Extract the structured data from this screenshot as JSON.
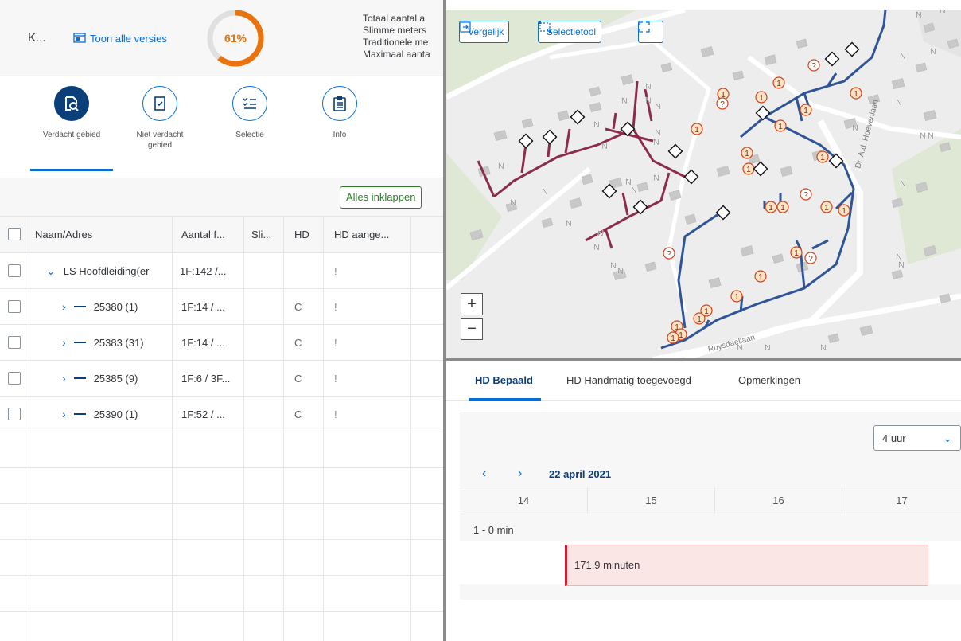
{
  "header": {
    "title": "K...",
    "versions_link": "Toon alle versies",
    "progress_percent": 61,
    "progress_label": "61%",
    "stats": [
      "Totaal aantal a",
      "Slimme meters",
      "Traditionele me",
      "Maximaal aanta"
    ]
  },
  "modes": [
    {
      "label": "Verdacht gebied",
      "icon": "magnifier-document-icon",
      "active": true
    },
    {
      "label": "Niet verdacht gebied",
      "icon": "checklist-document-icon",
      "active": false
    },
    {
      "label": "Selectie",
      "icon": "list-check-icon",
      "active": false
    },
    {
      "label": "Info",
      "icon": "clipboard-info-icon",
      "active": false
    }
  ],
  "toolbar": {
    "collapse_label": "Alles inklappen"
  },
  "table": {
    "columns": [
      "Naam/Adres",
      "Aantal f...",
      "Sli...",
      "HD",
      "HD aange..."
    ],
    "rows": [
      {
        "name": "LS Hoofdleiding(er",
        "aantal": "1F:142 /...",
        "sli": "",
        "hd": "",
        "hd_aange": "!",
        "expanded": true
      },
      {
        "name": "25380 (1)",
        "aantal": "1F:14 / ...",
        "sli": "",
        "hd": "C",
        "hd_aange": "!",
        "expanded": false
      },
      {
        "name": "25383 (31)",
        "aantal": "1F:14 / ...",
        "sli": "",
        "hd": "C",
        "hd_aange": "!",
        "expanded": false
      },
      {
        "name": "25385 (9)",
        "aantal": "1F:6 / 3F...",
        "sli": "",
        "hd": "C",
        "hd_aange": "!",
        "expanded": false
      },
      {
        "name": "25390 (1)",
        "aantal": "1F:52 / ...",
        "sli": "",
        "hd": "C",
        "hd_aange": "!",
        "expanded": false
      }
    ]
  },
  "map": {
    "buttons": {
      "compare": "Vergelijk",
      "select_tool": "Selectietool",
      "fullscreen": ""
    },
    "zoom_in": "+",
    "zoom_out": "−",
    "street_labels": [
      "Dr. A.d. Hoevenlaan",
      "Ruysdaellaan"
    ],
    "marker_letter": "N",
    "marker_count": "1",
    "marker_unknown": "?",
    "colors": {
      "network_blue": "#2f5597",
      "network_red": "#8b2d4a",
      "marker_orange": "#e9730c"
    }
  },
  "tabs": [
    {
      "label": "HD Bepaald",
      "active": true
    },
    {
      "label": "HD Handmatig toegevoegd",
      "active": false
    },
    {
      "label": "Opmerkingen",
      "active": false
    }
  ],
  "timeline": {
    "interval": "4 uur",
    "date": "22 april 2021",
    "hours": [
      "14",
      "15",
      "16",
      "17"
    ],
    "lane_label": "1 - 0 min",
    "event_label": "171.9 minuten"
  }
}
